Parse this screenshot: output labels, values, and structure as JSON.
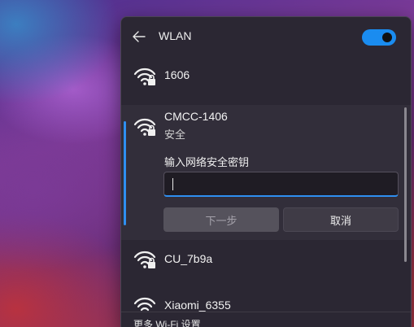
{
  "header": {
    "title": "WLAN",
    "wifi_enabled": true
  },
  "networks": [
    {
      "name": "1606",
      "status": "",
      "secured": true
    },
    {
      "name": "CMCC-1406",
      "status": "安全",
      "secured": true,
      "expanded": true
    },
    {
      "name": "CU_7b9a",
      "status": "",
      "secured": true
    },
    {
      "name": "Xiaomi_6355",
      "status": "",
      "secured": true
    }
  ],
  "connect_form": {
    "key_label": "输入网络安全密钥",
    "password_value": "",
    "next_label": "下一步",
    "cancel_label": "取消"
  },
  "footer": {
    "settings_link": "更多 Wi-Fi 设置"
  },
  "colors": {
    "accent": "#2e8ff0",
    "panel": "#2b2733",
    "toggle_on": "#1a8cf0"
  }
}
